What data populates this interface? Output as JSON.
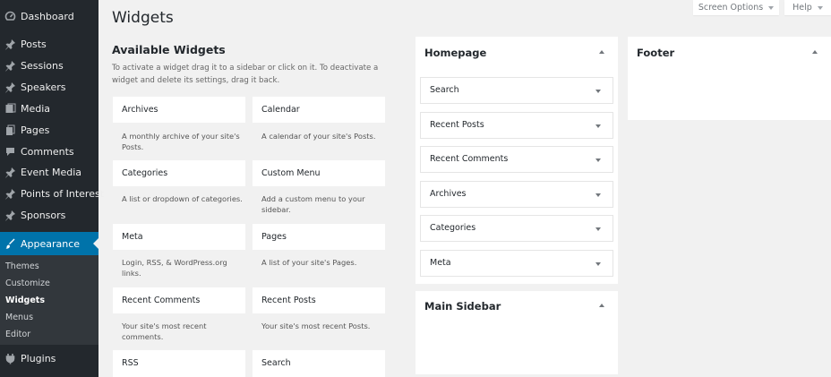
{
  "sidebar": {
    "items": [
      {
        "label": "Dashboard",
        "icon": "dashboard-icon"
      },
      {
        "label": "Posts",
        "icon": "pin-icon"
      },
      {
        "label": "Sessions",
        "icon": "pin-icon"
      },
      {
        "label": "Speakers",
        "icon": "pin-icon"
      },
      {
        "label": "Media",
        "icon": "media-icon"
      },
      {
        "label": "Pages",
        "icon": "pages-icon"
      },
      {
        "label": "Comments",
        "icon": "comment-icon"
      },
      {
        "label": "Event Media",
        "icon": "pin-icon"
      },
      {
        "label": "Points of Interest",
        "icon": "pin-icon"
      },
      {
        "label": "Sponsors",
        "icon": "pin-icon"
      },
      {
        "label": "Appearance",
        "icon": "brush-icon"
      },
      {
        "label": "Plugins",
        "icon": "plugin-icon"
      }
    ],
    "submenu": [
      "Themes",
      "Customize",
      "Widgets",
      "Menus",
      "Editor"
    ],
    "active_color": "#0073aa"
  },
  "header": {
    "title": "Widgets",
    "screen_options": "Screen Options",
    "help": "Help"
  },
  "available": {
    "title": "Available Widgets",
    "description": "To activate a widget drag it to a sidebar or click on it. To deactivate a widget and delete its settings, drag it back.",
    "widgets": [
      {
        "title": "Archives",
        "desc": "A monthly archive of your site's Posts."
      },
      {
        "title": "Calendar",
        "desc": "A calendar of your site's Posts."
      },
      {
        "title": "Categories",
        "desc": "A list or dropdown of categories."
      },
      {
        "title": "Custom Menu",
        "desc": "Add a custom menu to your sidebar."
      },
      {
        "title": "Meta",
        "desc": "Login, RSS, & WordPress.org links."
      },
      {
        "title": "Pages",
        "desc": "A list of your site's Pages."
      },
      {
        "title": "Recent Comments",
        "desc": "Your site's most recent comments."
      },
      {
        "title": "Recent Posts",
        "desc": "Your site's most recent Posts."
      },
      {
        "title": "RSS",
        "desc": ""
      },
      {
        "title": "Search",
        "desc": ""
      }
    ]
  },
  "areas": {
    "homepage": {
      "title": "Homepage",
      "widgets": [
        "Search",
        "Recent Posts",
        "Recent Comments",
        "Archives",
        "Categories",
        "Meta"
      ]
    },
    "main_sidebar": {
      "title": "Main Sidebar"
    },
    "footer": {
      "title": "Footer"
    }
  }
}
